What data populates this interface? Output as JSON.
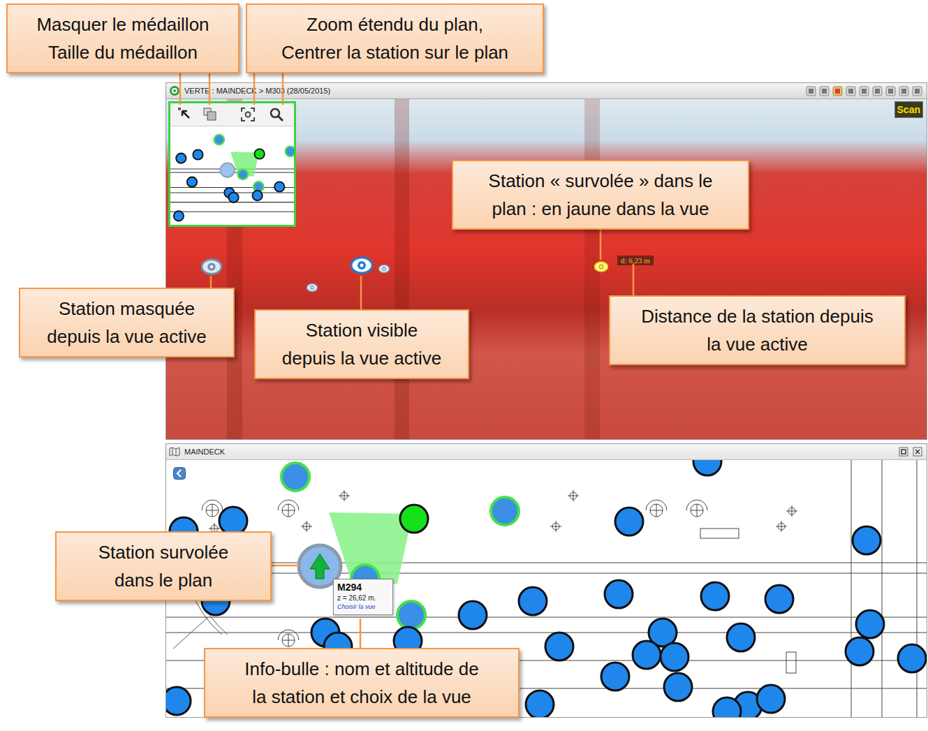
{
  "viewer": {
    "title": "VERTE : MAINDECK > M303 (28/05/2015)",
    "scan": "Scan",
    "distance": "d: 6,23 m",
    "markers": [
      {
        "kind": "masked"
      },
      {
        "kind": "visible"
      },
      {
        "kind": "small"
      },
      {
        "kind": "small"
      },
      {
        "kind": "hovered"
      }
    ]
  },
  "plan": {
    "title": "MAINDECK",
    "stations": [
      {
        "kind": "visited"
      },
      {
        "kind": "plain"
      },
      {
        "kind": "plain"
      },
      {
        "kind": "plain"
      },
      {
        "kind": "current"
      },
      {
        "kind": "visited"
      },
      {
        "kind": "plain"
      },
      {
        "kind": "plain"
      },
      {
        "kind": "plain"
      },
      {
        "kind": "plain"
      },
      {
        "kind": "plain"
      },
      {
        "kind": "plain"
      },
      {
        "kind": "plain"
      },
      {
        "kind": "visited"
      },
      {
        "kind": "plain"
      },
      {
        "kind": "visited"
      },
      {
        "kind": "plain"
      },
      {
        "kind": "plain"
      },
      {
        "kind": "plain"
      },
      {
        "kind": "plain"
      },
      {
        "kind": "plain"
      },
      {
        "kind": "plain"
      },
      {
        "kind": "plain"
      },
      {
        "kind": "plain"
      },
      {
        "kind": "plain"
      },
      {
        "kind": "plain"
      },
      {
        "kind": "plain"
      },
      {
        "kind": "plain"
      },
      {
        "kind": "plain"
      },
      {
        "kind": "plain"
      },
      {
        "kind": "plain"
      },
      {
        "kind": "plain"
      },
      {
        "kind": "plain"
      },
      {
        "kind": "plain"
      }
    ],
    "hovered": {
      "name": "M294",
      "altitude": "z = 26,62 m.",
      "action": "Choisir la vue"
    }
  },
  "callouts": [
    {
      "lines": [
        "Masquer le médaillon",
        "Taille du médaillon"
      ]
    },
    {
      "lines": [
        "Zoom étendu du plan,",
        "Centrer la station sur le plan"
      ]
    },
    {
      "lines": [
        "Station « survolée » dans le",
        "plan : en jaune dans la vue"
      ]
    },
    {
      "lines": [
        "Station masquée",
        "depuis la vue active"
      ]
    },
    {
      "lines": [
        "Station visible",
        "depuis la vue active"
      ]
    },
    {
      "lines": [
        "Distance de la station depuis",
        "la vue active"
      ]
    },
    {
      "lines": [
        "Station survolée",
        "dans le plan"
      ]
    },
    {
      "lines": [
        "Info-bulle : nom et altitude de",
        "la station et choix de la vue"
      ]
    }
  ]
}
